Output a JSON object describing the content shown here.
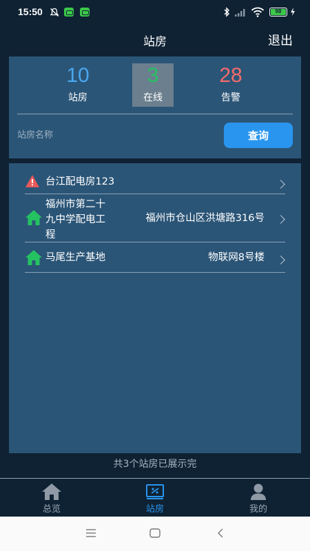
{
  "status": {
    "time": "15:50",
    "battery": "98",
    "icons": [
      "mute-icon",
      "app-badge-icon",
      "app-badge-icon",
      "bluetooth-icon",
      "signal-icon",
      "wifi-icon",
      "battery-icon",
      "charging-icon"
    ]
  },
  "header": {
    "title": "站房",
    "logout": "退出"
  },
  "summary": {
    "total": {
      "value": "10",
      "label": "站房"
    },
    "online": {
      "value": "3",
      "label": "在线"
    },
    "alarm": {
      "value": "28",
      "label": "告警"
    }
  },
  "search": {
    "placeholder": "站房名称",
    "button": "查询"
  },
  "stations": [
    {
      "name": "台江配电房123",
      "address": "",
      "icon": "warning-icon"
    },
    {
      "name": "福州市第二十九中学配电工程",
      "address": "福州市仓山区洪塘路316号",
      "icon": "home-icon"
    },
    {
      "name": "马尾生产基地",
      "address": "物联网8号楼",
      "icon": "home-icon"
    }
  ],
  "list_footer": "共3个站房已展示完",
  "tabs": [
    {
      "label": "总览",
      "icon": "home-tab-icon"
    },
    {
      "label": "站房",
      "icon": "station-tab-icon",
      "active": true
    },
    {
      "label": "我的",
      "icon": "user-tab-icon"
    }
  ],
  "colors": {
    "background": "#0f2233",
    "panel": "#2b5577",
    "accent": "#2a95ef",
    "online": "#25c262",
    "alarm": "#f26b6b",
    "total": "#4aa7ee"
  }
}
